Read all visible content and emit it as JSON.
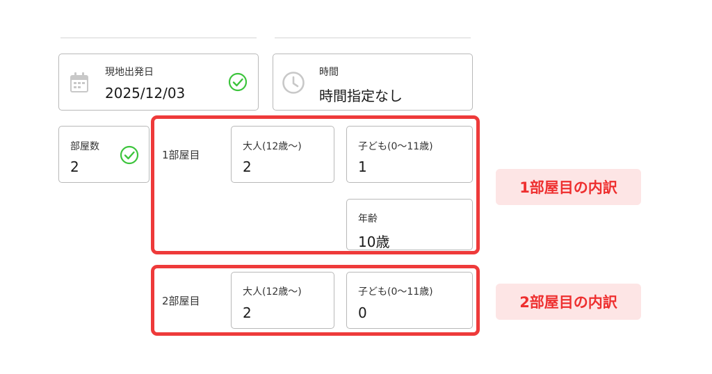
{
  "departure": {
    "label": "現地出発日",
    "value": "2025/12/03",
    "icon": "calendar-icon",
    "status_icon": "check-circle-icon"
  },
  "time": {
    "label": "時間",
    "value": "時間指定なし",
    "icon": "clock-icon"
  },
  "rooms_count": {
    "label": "部屋数",
    "value": "2",
    "status_icon": "check-circle-icon"
  },
  "rooms": [
    {
      "label": "1部屋目",
      "adults": {
        "label": "大人(12歳〜)",
        "value": "2"
      },
      "children": {
        "label": "子ども(0〜11歳)",
        "value": "1"
      },
      "age": {
        "label": "年齢",
        "value": "10歳"
      }
    },
    {
      "label": "2部屋目",
      "adults": {
        "label": "大人(12歳〜)",
        "value": "2"
      },
      "children": {
        "label": "子ども(0〜11歳)",
        "value": "0"
      }
    }
  ],
  "annotations": {
    "room1": "1部屋目の内訳",
    "room2": "2部屋目の内訳"
  },
  "colors": {
    "highlight": "#ee3a3a",
    "callout_bg": "#fde5e5",
    "check": "#3cc43c",
    "icon_gray": "#c8c8c8"
  }
}
